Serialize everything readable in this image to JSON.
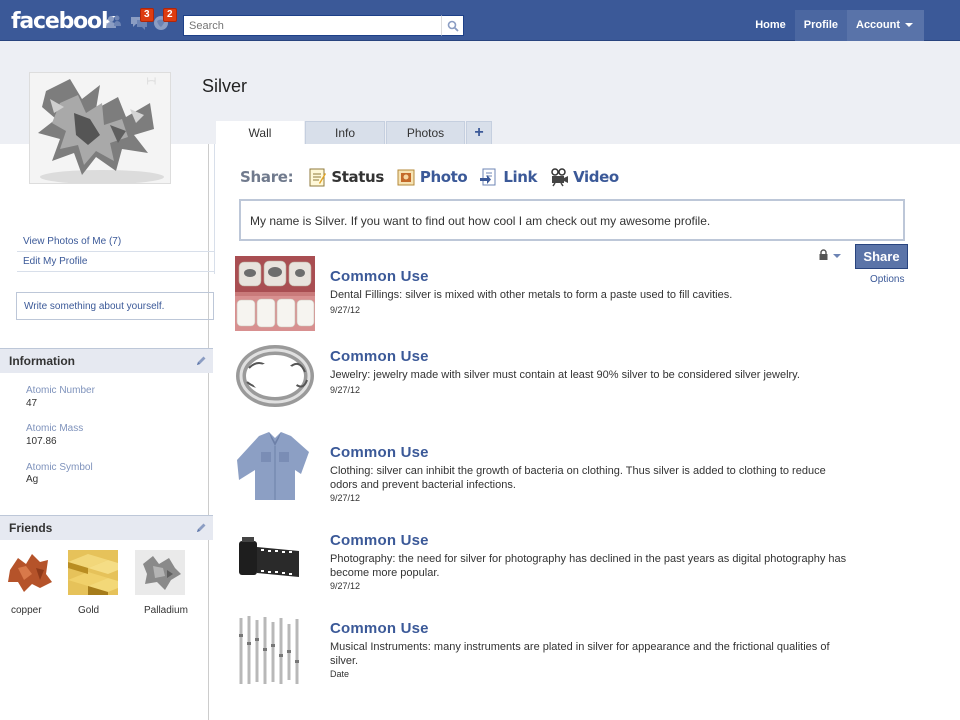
{
  "topbar": {
    "logo": "facebook",
    "friend_requests_count": "",
    "messages_count": "3",
    "notifications_count": "2",
    "search_placeholder": "Search",
    "nav": [
      "Home",
      "Profile",
      "Account"
    ]
  },
  "profile": {
    "name": "Silver"
  },
  "tabs": [
    "Wall",
    "Info",
    "Photos",
    "+"
  ],
  "left": {
    "links": [
      "View Photos of Me (7)",
      "Edit My Profile"
    ],
    "about_prompt": "Write something about yourself.",
    "information_heading": "Information",
    "info": [
      {
        "label": "Atomic Number",
        "value": "47"
      },
      {
        "label": "Atomic Mass",
        "value": "107.86"
      },
      {
        "label": "Atomic Symbol",
        "value": "Ag"
      }
    ],
    "friends_heading": "Friends",
    "friends": [
      "copper",
      "Gold",
      "Palladium"
    ]
  },
  "share": {
    "label": "Share:",
    "items": [
      "Status",
      "Photo",
      "Link",
      "Video"
    ],
    "status_text": "My name is Silver. If you want to find out how cool I am check out my awesome profile.",
    "button": "Share",
    "options": "Options"
  },
  "posts": [
    {
      "title": "Common Use",
      "body": "Dental Fillings: silver is mixed with other metals to form a paste used to fill cavities.",
      "date": "9/27/12"
    },
    {
      "title": "Common Use",
      "body": "Jewelry: jewelry made with silver must contain at least 90% silver to be considered silver jewelry.",
      "date": "9/27/12"
    },
    {
      "title": "Common Use",
      "body": "Clothing: silver can inhibit the growth of bacteria on clothing. Thus silver is added to clothing to reduce odors and prevent bacterial infections.",
      "date": "9/27/12"
    },
    {
      "title": "Common Use",
      "body": "Photography: the need for silver for photography has declined in the past years as digital photography has become more popular.",
      "date": "9/27/12"
    },
    {
      "title": "Common Use",
      "body": "Musical Instruments: many instruments are plated in silver for appearance and the frictional qualities of silver.",
      "date": "Date"
    }
  ],
  "colors": {
    "brand_blue": "#3b5998",
    "band_gray": "#edeff4",
    "badge_red": "#dd3c10"
  },
  "icons": [
    "friends-icon",
    "messages-icon",
    "notifications-icon",
    "search-icon",
    "lock-icon",
    "pencil-icon"
  ]
}
